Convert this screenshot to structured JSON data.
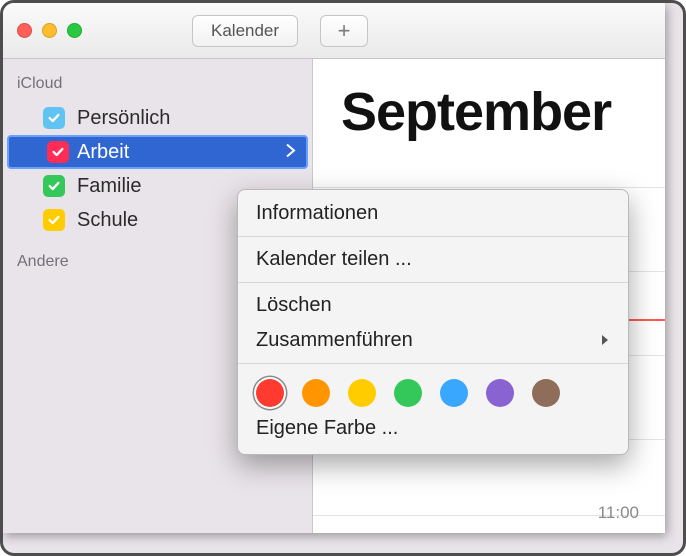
{
  "titlebar": {
    "app_label": "Kalender",
    "add_glyph": "+"
  },
  "sidebar": {
    "section_icloud": "iCloud",
    "section_other": "Andere",
    "items": [
      {
        "label": "Persönlich",
        "color": "#60c4f2",
        "selected": false
      },
      {
        "label": "Arbeit",
        "color": "#ff2d55",
        "selected": true
      },
      {
        "label": "Familie",
        "color": "#34c759",
        "selected": false
      },
      {
        "label": "Schule",
        "color": "#ffcc00",
        "selected": false
      }
    ]
  },
  "main": {
    "month": "September",
    "time_label": "11:00"
  },
  "context_menu": {
    "info": "Informationen",
    "share": "Kalender teilen ...",
    "delete": "Löschen",
    "merge": "Zusammenführen",
    "custom_color": "Eigene Farbe ...",
    "colors": [
      "#ff3b30",
      "#ff9500",
      "#ffcc00",
      "#34c759",
      "#3aa7ff",
      "#8a63d2",
      "#8e6e5a"
    ],
    "selected_color_index": 0
  }
}
